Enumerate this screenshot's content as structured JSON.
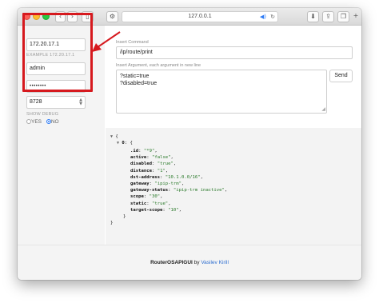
{
  "browser": {
    "url": "127.0.0.1",
    "back_icon": "chevron-left",
    "forward_icon": "chevron-right",
    "sidebar_icon": "sidebar-toggle",
    "settings_icon": "gear",
    "audio_icon": "speaker",
    "reload_icon": "reload",
    "download_icon": "download",
    "share_icon": "share",
    "tabs_icon": "tabs",
    "new_tab_icon": "plus"
  },
  "sidebar": {
    "host_value": "172.20.17.1",
    "host_example": "EXAMPLE 172.20.17.1",
    "user_value": "admin",
    "password_mask": "••••••••",
    "port_value": "8728",
    "show_debug_label": "SHOW DEBUG",
    "radio_yes": "YES",
    "radio_no": "NO",
    "selected_radio": "NO"
  },
  "main": {
    "insert_command_label": "Insert Command",
    "command_value": "/ip/route/print",
    "insert_argument_label": "Insert Argument, each argument in new line",
    "argument_line_1": "?static=true",
    "argument_line_2": "?disabled=true",
    "send_label": "Send"
  },
  "output": {
    "open_brace": "{",
    "entry_key": "0",
    "close_brace": "}",
    "entry_close": "}",
    "rows": [
      {
        "key": ".id",
        "value": "\"*9\""
      },
      {
        "key": "active",
        "value": "\"false\""
      },
      {
        "key": "disabled",
        "value": "\"true\""
      },
      {
        "key": "distance",
        "value": "\"1\""
      },
      {
        "key": "dst-address",
        "value": "\"10.1.0.0/16\""
      },
      {
        "key": "gateway",
        "value": "\"ipip-trm\""
      },
      {
        "key": "gateway-status",
        "value": "\"ipip-trm inactive\""
      },
      {
        "key": "scope",
        "value": "\"30\""
      },
      {
        "key": "static",
        "value": "\"true\""
      },
      {
        "key": "target-scope",
        "value": "\"10\""
      }
    ]
  },
  "footer": {
    "app_name": "RouterOSAPIGUI",
    "by_text": " by ",
    "author": "Vasilev Kirill"
  },
  "colors": {
    "highlight": "#d6191e",
    "link": "#2f6fd0"
  }
}
